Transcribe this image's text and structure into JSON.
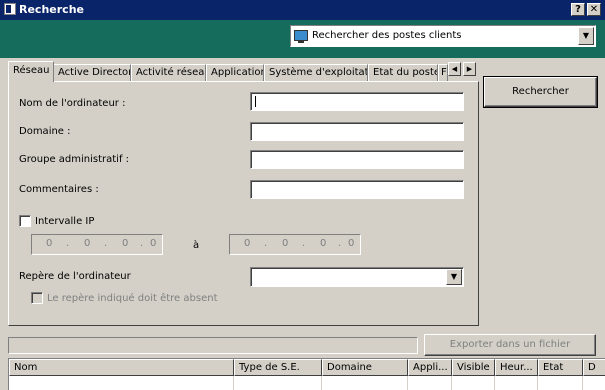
{
  "window": {
    "title": "Recherche",
    "help_glyph": "?",
    "close_glyph": "✕"
  },
  "header": {
    "search_type": "Rechercher des postes clients",
    "dropdown_glyph": "▼"
  },
  "tabs": [
    "Réseau",
    "Active Directory",
    "Activité réseau",
    "Application",
    "Système d'exploitation",
    "Etat du poste",
    "F"
  ],
  "tab_scroll": {
    "left": "◀",
    "right": "▶"
  },
  "form": {
    "computer_name_label": "Nom de l'ordinateur :",
    "computer_name_value": "",
    "domain_label": "Domaine :",
    "domain_value": "",
    "admin_group_label": "Groupe administratif :",
    "admin_group_value": "",
    "comments_label": "Commentaires :",
    "comments_value": "",
    "ip_range_label": "Intervalle IP",
    "ip_range_checked": false,
    "ip_from_octets": [
      "0",
      "0",
      "0",
      "0"
    ],
    "ip_to_octets": [
      "0",
      "0",
      "0",
      "0"
    ],
    "ip_dot": ".",
    "ip_separator": "à",
    "tag_label": "Repère de l'ordinateur",
    "tag_value": "",
    "tag_absent_label": "Le repère indiqué doit être absent",
    "tag_absent_checked": false
  },
  "actions": {
    "search_label": "Rechercher",
    "export_label": "Exporter dans un fichier"
  },
  "results": {
    "columns": [
      "Nom",
      "Type de S.E.",
      "Domaine",
      "Appli...",
      "Visible",
      "Heur...",
      "Etat",
      "D"
    ]
  }
}
